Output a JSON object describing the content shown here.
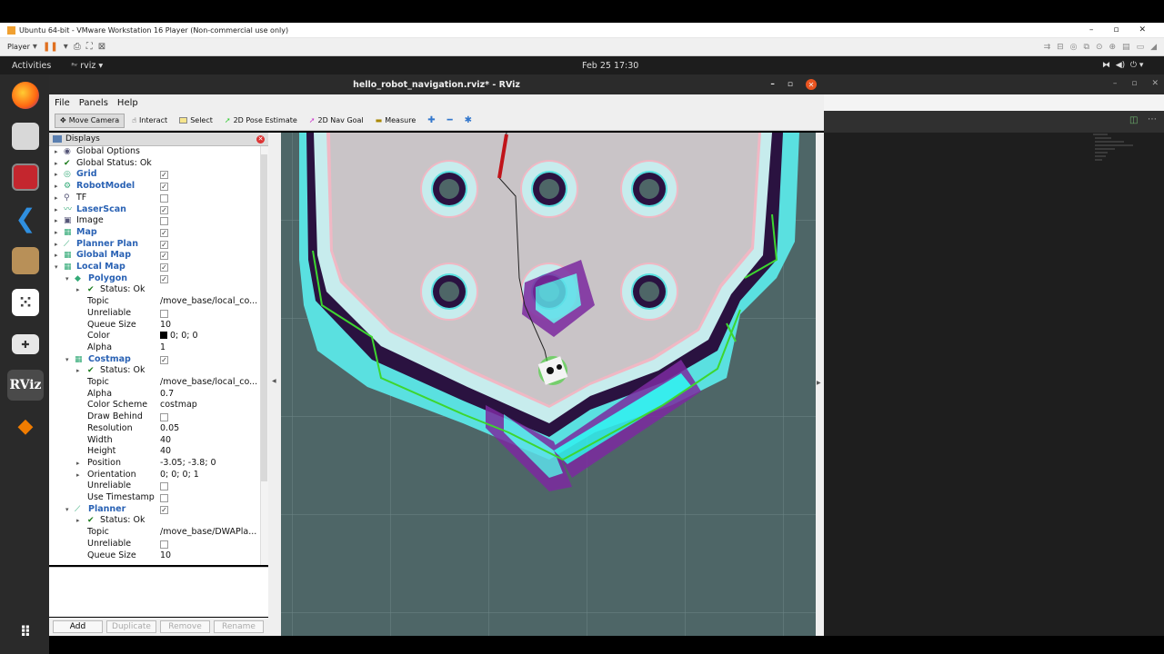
{
  "vm": {
    "title": "Ubuntu 64-bit - VMware Workstation 16 Player (Non-commercial use only)",
    "player_label": "Player"
  },
  "ubuntu": {
    "activities": "Activities",
    "app_menu": "rviz",
    "clock": "Feb 25  17:30"
  },
  "dock": {
    "apps": [
      "firefox-icon",
      "files-icon",
      "red-app-icon",
      "vscode-icon",
      "software-icon",
      "game-icon",
      "rviz-icon",
      "layers-icon",
      "app-grid-icon"
    ],
    "rviz_label": "RViz"
  },
  "rviz": {
    "title": "hello_robot_navigation.rviz* - RViz",
    "menu": [
      "File",
      "Panels",
      "Help"
    ],
    "tools": [
      "Move Camera",
      "Interact",
      "Select",
      "2D Pose Estimate",
      "2D Nav Goal",
      "Measure"
    ],
    "displays_title": "Displays",
    "rows": [
      {
        "i": 0,
        "a": "▸",
        "icon": "◉",
        "l": "Global Options",
        "b": false,
        "c": null,
        "v": ""
      },
      {
        "i": 0,
        "a": "▸",
        "icon": "✔",
        "l": "Global Status: Ok",
        "b": false,
        "c": null,
        "v": ""
      },
      {
        "i": 0,
        "a": "▸",
        "icon": "◎",
        "l": "Grid",
        "b": true,
        "c": true,
        "v": ""
      },
      {
        "i": 0,
        "a": "▸",
        "icon": "⚙",
        "l": "RobotModel",
        "b": true,
        "c": true,
        "v": ""
      },
      {
        "i": 0,
        "a": "▸",
        "icon": "⚲",
        "l": "TF",
        "b": false,
        "c": false,
        "v": ""
      },
      {
        "i": 0,
        "a": "▸",
        "icon": "〰",
        "l": "LaserScan",
        "b": true,
        "c": true,
        "v": ""
      },
      {
        "i": 0,
        "a": "▸",
        "icon": "▣",
        "l": "Image",
        "b": false,
        "c": false,
        "v": ""
      },
      {
        "i": 0,
        "a": "▸",
        "icon": "▦",
        "l": "Map",
        "b": true,
        "c": true,
        "v": ""
      },
      {
        "i": 0,
        "a": "▸",
        "icon": "⟋",
        "l": "Planner Plan",
        "b": true,
        "c": true,
        "v": ""
      },
      {
        "i": 0,
        "a": "▸",
        "icon": "▦",
        "l": "Global Map",
        "b": true,
        "c": true,
        "v": ""
      },
      {
        "i": 0,
        "a": "▾",
        "icon": "▦",
        "l": "Local Map",
        "b": true,
        "c": true,
        "v": ""
      },
      {
        "i": 1,
        "a": "▾",
        "icon": "◆",
        "l": "Polygon",
        "b": true,
        "c": true,
        "v": ""
      },
      {
        "i": 2,
        "a": "▸",
        "icon": "✔",
        "l": "Status: Ok",
        "b": false,
        "c": null,
        "v": ""
      },
      {
        "i": 2,
        "a": "",
        "icon": "",
        "l": "Topic",
        "b": false,
        "c": null,
        "v": "/move_base/local_co..."
      },
      {
        "i": 2,
        "a": "",
        "icon": "",
        "l": "Unreliable",
        "b": false,
        "c": false,
        "v": ""
      },
      {
        "i": 2,
        "a": "",
        "icon": "",
        "l": "Queue Size",
        "b": false,
        "c": null,
        "v": "10"
      },
      {
        "i": 2,
        "a": "",
        "icon": "",
        "l": "Color",
        "b": false,
        "c": null,
        "v": "0; 0; 0",
        "sw": true
      },
      {
        "i": 2,
        "a": "",
        "icon": "",
        "l": "Alpha",
        "b": false,
        "c": null,
        "v": "1"
      },
      {
        "i": 1,
        "a": "▾",
        "icon": "▦",
        "l": "Costmap",
        "b": true,
        "c": true,
        "v": ""
      },
      {
        "i": 2,
        "a": "▸",
        "icon": "✔",
        "l": "Status: Ok",
        "b": false,
        "c": null,
        "v": ""
      },
      {
        "i": 2,
        "a": "",
        "icon": "",
        "l": "Topic",
        "b": false,
        "c": null,
        "v": "/move_base/local_co..."
      },
      {
        "i": 2,
        "a": "",
        "icon": "",
        "l": "Alpha",
        "b": false,
        "c": null,
        "v": "0.7"
      },
      {
        "i": 2,
        "a": "",
        "icon": "",
        "l": "Color Scheme",
        "b": false,
        "c": null,
        "v": "costmap"
      },
      {
        "i": 2,
        "a": "",
        "icon": "",
        "l": "Draw Behind",
        "b": false,
        "c": false,
        "v": ""
      },
      {
        "i": 2,
        "a": "",
        "icon": "",
        "l": "Resolution",
        "b": false,
        "c": null,
        "v": "0.05"
      },
      {
        "i": 2,
        "a": "",
        "icon": "",
        "l": "Width",
        "b": false,
        "c": null,
        "v": "40"
      },
      {
        "i": 2,
        "a": "",
        "icon": "",
        "l": "Height",
        "b": false,
        "c": null,
        "v": "40"
      },
      {
        "i": 2,
        "a": "▸",
        "icon": "",
        "l": "Position",
        "b": false,
        "c": null,
        "v": "-3.05; -3.8; 0"
      },
      {
        "i": 2,
        "a": "▸",
        "icon": "",
        "l": "Orientation",
        "b": false,
        "c": null,
        "v": "0; 0; 0; 1"
      },
      {
        "i": 2,
        "a": "",
        "icon": "",
        "l": "Unreliable",
        "b": false,
        "c": false,
        "v": ""
      },
      {
        "i": 2,
        "a": "",
        "icon": "",
        "l": "Use Timestamp",
        "b": false,
        "c": false,
        "v": ""
      },
      {
        "i": 1,
        "a": "▾",
        "icon": "⟋",
        "l": "Planner",
        "b": true,
        "c": true,
        "v": ""
      },
      {
        "i": 2,
        "a": "▸",
        "icon": "✔",
        "l": "Status: Ok",
        "b": false,
        "c": null,
        "v": ""
      },
      {
        "i": 2,
        "a": "",
        "icon": "",
        "l": "Topic",
        "b": false,
        "c": null,
        "v": "/move_base/DWAPla..."
      },
      {
        "i": 2,
        "a": "",
        "icon": "",
        "l": "Unreliable",
        "b": false,
        "c": false,
        "v": ""
      },
      {
        "i": 2,
        "a": "",
        "icon": "",
        "l": "Queue Size",
        "b": false,
        "c": null,
        "v": "10"
      }
    ],
    "buttons": [
      "Add",
      "Duplicate",
      "Remove",
      "Rename"
    ]
  }
}
